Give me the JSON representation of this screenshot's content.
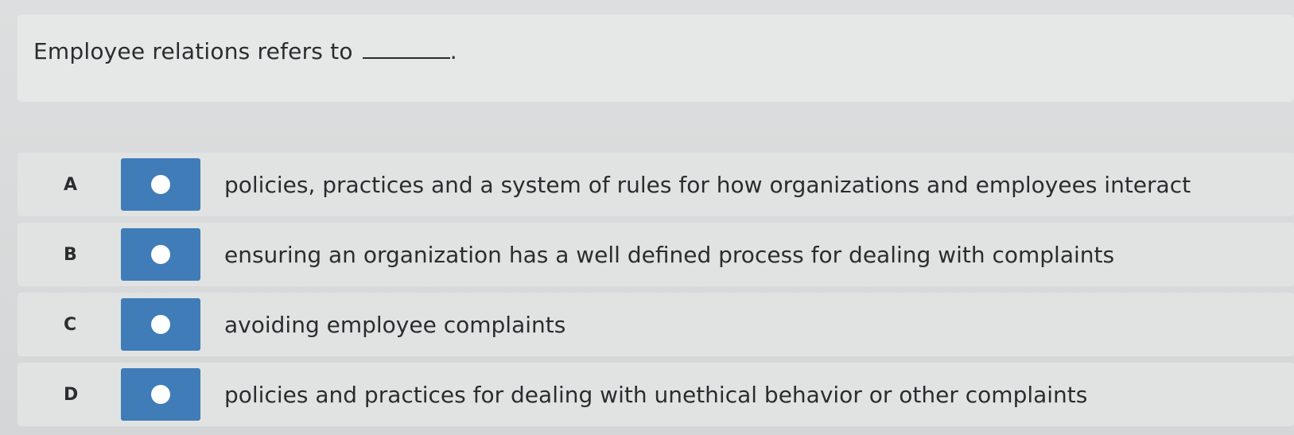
{
  "question": {
    "text": "Employee relations refers to",
    "suffix": "."
  },
  "options": [
    {
      "letter": "A",
      "text": "policies, practices and a system of rules for how organizations and employees interact"
    },
    {
      "letter": "B",
      "text": "ensuring an organization has a well defined process for dealing with complaints"
    },
    {
      "letter": "C",
      "text": "avoiding employee complaints"
    },
    {
      "letter": "D",
      "text": "policies and practices for dealing with unethical behavior or other complaints"
    }
  ],
  "colors": {
    "radio_box": "#3f7cb8",
    "radio_dot": "#ffffff",
    "background": "#d6d8da"
  }
}
